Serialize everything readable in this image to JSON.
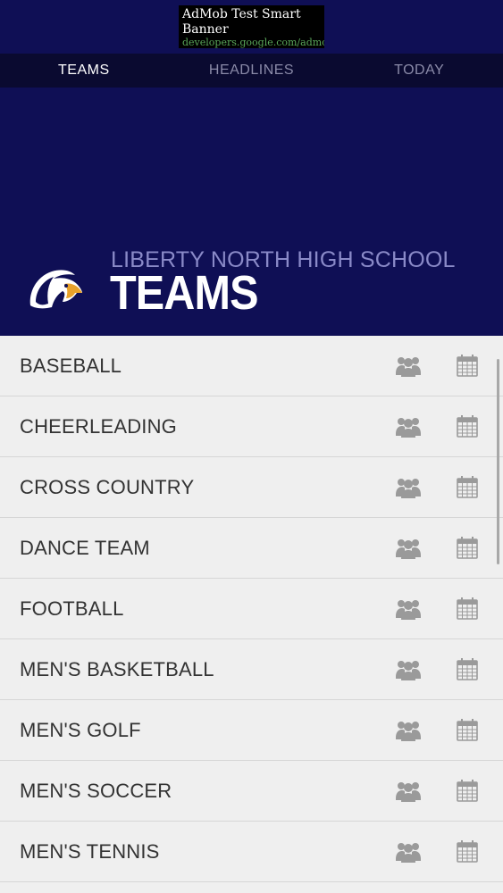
{
  "ad": {
    "title": "AdMob Test Smart Banner",
    "url": "developers.google.com/admob"
  },
  "tabs": [
    {
      "label": "TEAMS",
      "active": true
    },
    {
      "label": "HEADLINES",
      "active": false
    },
    {
      "label": "TODAY",
      "active": false
    }
  ],
  "header": {
    "school": "LIBERTY NORTH HIGH SCHOOL",
    "title": "TEAMS",
    "logo_icon": "eagle-logo-icon"
  },
  "teams": [
    {
      "name": "BASEBALL"
    },
    {
      "name": "CHEERLEADING"
    },
    {
      "name": "CROSS COUNTRY"
    },
    {
      "name": "DANCE TEAM"
    },
    {
      "name": "FOOTBALL"
    },
    {
      "name": "MEN'S BASKETBALL"
    },
    {
      "name": "MEN'S GOLF"
    },
    {
      "name": "MEN'S SOCCER"
    },
    {
      "name": "MEN'S TENNIS"
    }
  ],
  "icons": {
    "roster": "people-group-icon",
    "schedule": "calendar-icon"
  },
  "colors": {
    "brand_navy": "#0f0f55",
    "tab_bar": "#0a0a30",
    "tab_inactive": "#8a8aa8",
    "school_text": "#8a8ac8",
    "row_bg": "#efefef",
    "icon_gray": "#9a9a9a"
  }
}
